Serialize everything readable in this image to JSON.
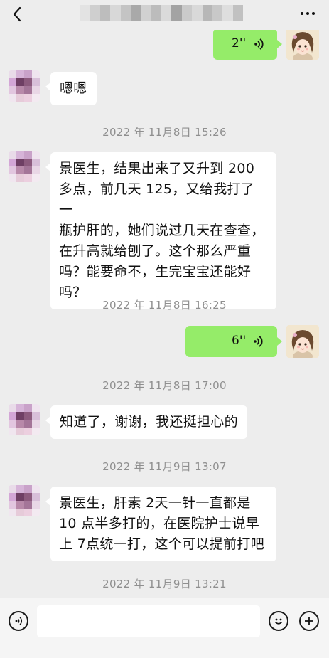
{
  "messages": {
    "voice1": {
      "duration": "2''"
    },
    "msg1": {
      "text": "嗯嗯"
    },
    "ts1": {
      "text": "2022 年 11月8日 15:26"
    },
    "msg2": {
      "lines": [
        "景医生，结果出来了又升到 200",
        "多点，前几天 125，又给我打了一",
        "瓶护肝的，她们说过几天在查查，",
        "在升高就给刨了。这个那么严重",
        "吗？能要命不，生完宝宝还能好",
        "吗？"
      ]
    },
    "ts2": {
      "text": "2022 年 11月8日 16:25"
    },
    "voice2": {
      "duration": "6''"
    },
    "ts3": {
      "text": "2022 年 11月8日 17:00"
    },
    "msg3": {
      "text": "知道了，谢谢，我还挺担心的"
    },
    "ts4": {
      "text": "2022 年 11月9日 13:07"
    },
    "msg4": {
      "lines": [
        "景医生，肝素 2天一针一直都是",
        "10 点半多打的，在医院护士说早",
        "上 7点统一打，这个可以提前打吧"
      ]
    },
    "ts5": {
      "text": "2022 年 11月9日 13:21"
    }
  },
  "icons": {
    "back": "chevron-left-icon",
    "more": "more-dots-icon",
    "voice_input": "voice-input-icon",
    "emoji": "emoji-icon",
    "add": "plus-icon"
  },
  "colors": {
    "background": "#ededed",
    "sent_bubble": "#95ec69",
    "received_bubble": "#ffffff",
    "timestamp": "#8f8f8f"
  }
}
